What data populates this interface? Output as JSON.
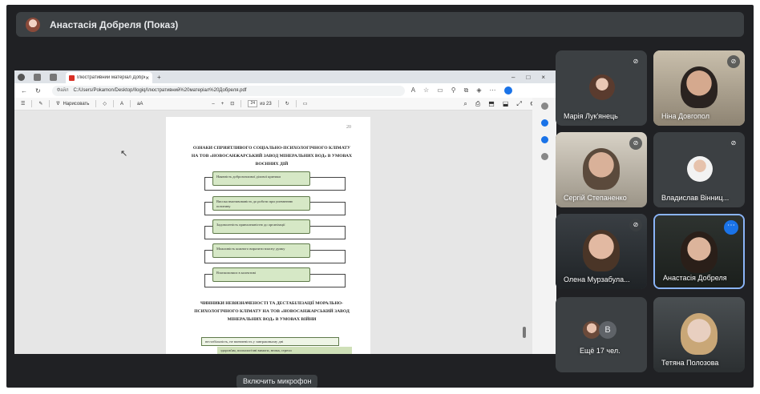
{
  "presentation": {
    "title": "Анастасія Добреля (Показ)"
  },
  "browser": {
    "tab_label": "Ілюстративний матеріал Добреля",
    "url_scheme": "Файл",
    "url": "C:/Users/Pokamon/Desktop/Ilogiq/Ілюстративний%20матеріал%20Добреля.pdf",
    "draw_label": "Нарисовать",
    "page_current": "24",
    "page_total": "из 23"
  },
  "pdf_page": {
    "page_number": "20",
    "title": "ОЗНАКИ СПРИЯТЛИВОГО СОЦІАЛЬНО-ПСИХОЛОГІЧНОГО КЛІМАТУ НА ТОВ «НОВОСАНЖАРСЬКИЙ ЗАВОД МІНЕРАЛЬНИХ ВОД» В УМОВАХ ВОЄННИХ ДІЙ",
    "boxes": [
      "Наявність доброзичливої ділової критики",
      "Висока вмотивованість до роботи при упевненню позитиву",
      "Задоволеність приналежністю до організації",
      "Можливість кожного виразити власну думку",
      "Взаємоповага в колективі"
    ],
    "section_title": "ЧИННИКИ НЕВИЗНАЧЕНОСТІ ТА ДЕСТАБІЛІЗАЦІЇ МОРАЛЬНО-ПСИХОЛОГІЧНОГО КЛІМАТУ НА ТОВ «НОВОСАНЖАРСЬКИЙ ЗАВОД МІНЕРАЛЬНИХ ВОД» В УМОВАХ ВІЙНИ",
    "arrow_rows": [
      "нестабільність, не впевненість у завтрашньому дні",
      "здоров'ям, психологічні вимоги, втома, стреси"
    ]
  },
  "participants": [
    {
      "name": "Марія Лук'янець",
      "muted": true
    },
    {
      "name": "Ніна Довгопол",
      "muted": true
    },
    {
      "name": "Сергій Степаненко",
      "muted": true
    },
    {
      "name": "Владислав Вінниц...",
      "muted": true
    },
    {
      "name": "Олена Мурзабула...",
      "muted": true
    },
    {
      "name": "Анастасія Добреля",
      "muted": false
    },
    {
      "name": "Тетяна Полозова",
      "muted": false
    }
  ],
  "others": {
    "label": "Ещё 17 чел.",
    "avatar_letter": "В"
  },
  "controls": {
    "mic_button": "Включить микрофон"
  }
}
